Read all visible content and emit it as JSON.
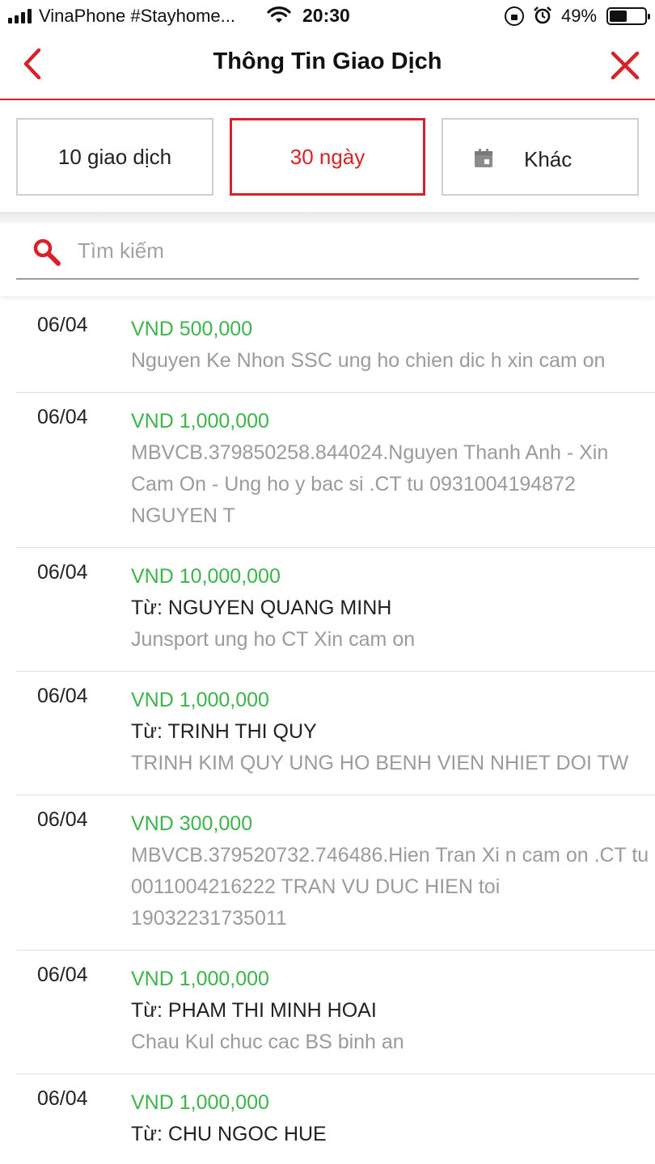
{
  "status_bar": {
    "carrier": "VinaPhone #Stayhome...",
    "time": "20:30",
    "battery": "49%",
    "battery_level": 0.49
  },
  "nav": {
    "title": "Thông Tin Giao Dịch",
    "back_icon": "chevron-left-icon",
    "close_icon": "close-icon",
    "accent_color": "#d8222a"
  },
  "filters": {
    "option1": "10 giao dịch",
    "option2": "30 ngày",
    "option3": "Khác",
    "selected": "30 ngày"
  },
  "search": {
    "placeholder": "Tìm kiếm"
  },
  "colors": {
    "amount": "#3bb54a",
    "description": "#9b9b9b"
  },
  "transactions": [
    {
      "date": "06/04",
      "amount": "VND 500,000",
      "from": "",
      "desc": "Nguyen Ke Nhon SSC ung ho chien dic h xin cam on"
    },
    {
      "date": "06/04",
      "amount": "VND 1,000,000",
      "from": "",
      "desc": "MBVCB.379850258.844024.Nguyen Thanh Anh - Xin Cam On - Ung ho y bac si .CT tu 0931004194872 NGUYEN T"
    },
    {
      "date": "06/04",
      "amount": "VND 10,000,000",
      "from": "Từ: NGUYEN QUANG MINH",
      "desc": "Junsport ung ho CT Xin cam on"
    },
    {
      "date": "06/04",
      "amount": "VND 1,000,000",
      "from": "Từ: TRINH THI QUY",
      "desc": "TRINH KIM QUY UNG HO BENH VIEN NHIET DOI TW"
    },
    {
      "date": "06/04",
      "amount": "VND 300,000",
      "from": "",
      "desc": "MBVCB.379520732.746486.Hien Tran Xi n cam on .CT tu 0011004216222 TRAN VU DUC HIEN toi 19032231735011"
    },
    {
      "date": "06/04",
      "amount": "VND 1,000,000",
      "from": "Từ: PHAM THI MINH HOAI",
      "desc": "Chau Kul chuc cac BS binh an"
    },
    {
      "date": "06/04",
      "amount": "VND 1,000,000",
      "from": "Từ: CHU NGOC HUE",
      "desc": ""
    }
  ]
}
